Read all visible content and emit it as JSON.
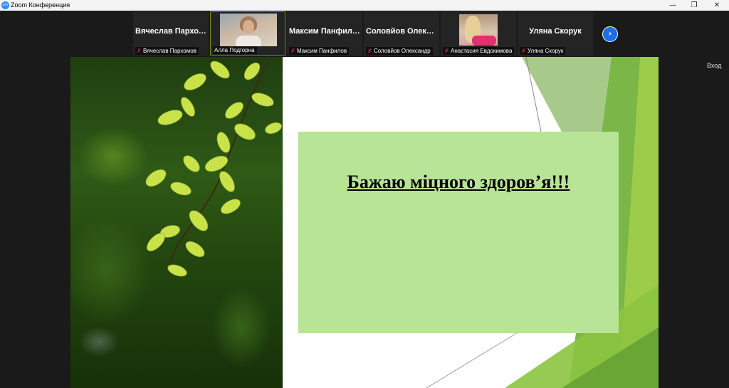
{
  "window": {
    "title": "Zoom Конференция",
    "app_icon": "zoom",
    "controls": [
      "minimize-icon",
      "restore-icon",
      "close-icon"
    ]
  },
  "gallery": {
    "tiles": [
      {
        "big_name": "Вячеслав Пархомов",
        "footer_name": "Вячеслав Пархомов",
        "video": false,
        "muted": true
      },
      {
        "big_name": "",
        "footer_name": "Алла Подгорна",
        "video": true,
        "muted": false,
        "active": true
      },
      {
        "big_name": "Максим  Панфилов",
        "footer_name": "Максим  Панфилов",
        "video": false,
        "muted": true
      },
      {
        "big_name": "Соловйов Олександр",
        "footer_name": "Соловйов Олександр",
        "video": false,
        "muted": true
      },
      {
        "big_name": "",
        "footer_name": "Анастасия Евдокимова",
        "video": true,
        "muted": true
      },
      {
        "big_name": "Уляна Скорук",
        "footer_name": "Уляна Скорук",
        "video": false,
        "muted": true
      }
    ],
    "next_icon": "chevron-right-icon"
  },
  "side": {
    "exit_label": "Вход"
  },
  "slide": {
    "text": "Бажаю міцного здоров’я!!!",
    "box_color": "#b7e497",
    "accent_colors": [
      "#7ab648",
      "#9ccc4a",
      "#5e9e2a"
    ]
  }
}
